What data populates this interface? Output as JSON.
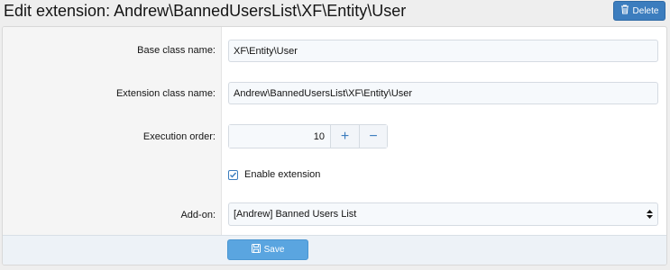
{
  "header": {
    "title": "Edit extension: Andrew\\BannedUsersList\\XF\\Entity\\User",
    "delete_label": "Delete",
    "delete_icon": "trash-icon"
  },
  "form": {
    "base_class": {
      "label": "Base class name:",
      "value": "XF\\Entity\\User"
    },
    "extension_class": {
      "label": "Extension class name:",
      "value": "Andrew\\BannedUsersList\\XF\\Entity\\User"
    },
    "execution_order": {
      "label": "Execution order:",
      "value": "10",
      "increment": "+",
      "decrement": "−"
    },
    "enable": {
      "label": "Enable extension",
      "checked": true
    },
    "addon": {
      "label": "Add-on:",
      "selected": "[Andrew] Banned Users List"
    }
  },
  "footer": {
    "save_label": "Save",
    "save_icon": "floppy-disk-icon"
  },
  "colors": {
    "accent": "#3c7dbe",
    "save_button": "#5aa5e0",
    "footer_bg": "#edf2f7"
  }
}
